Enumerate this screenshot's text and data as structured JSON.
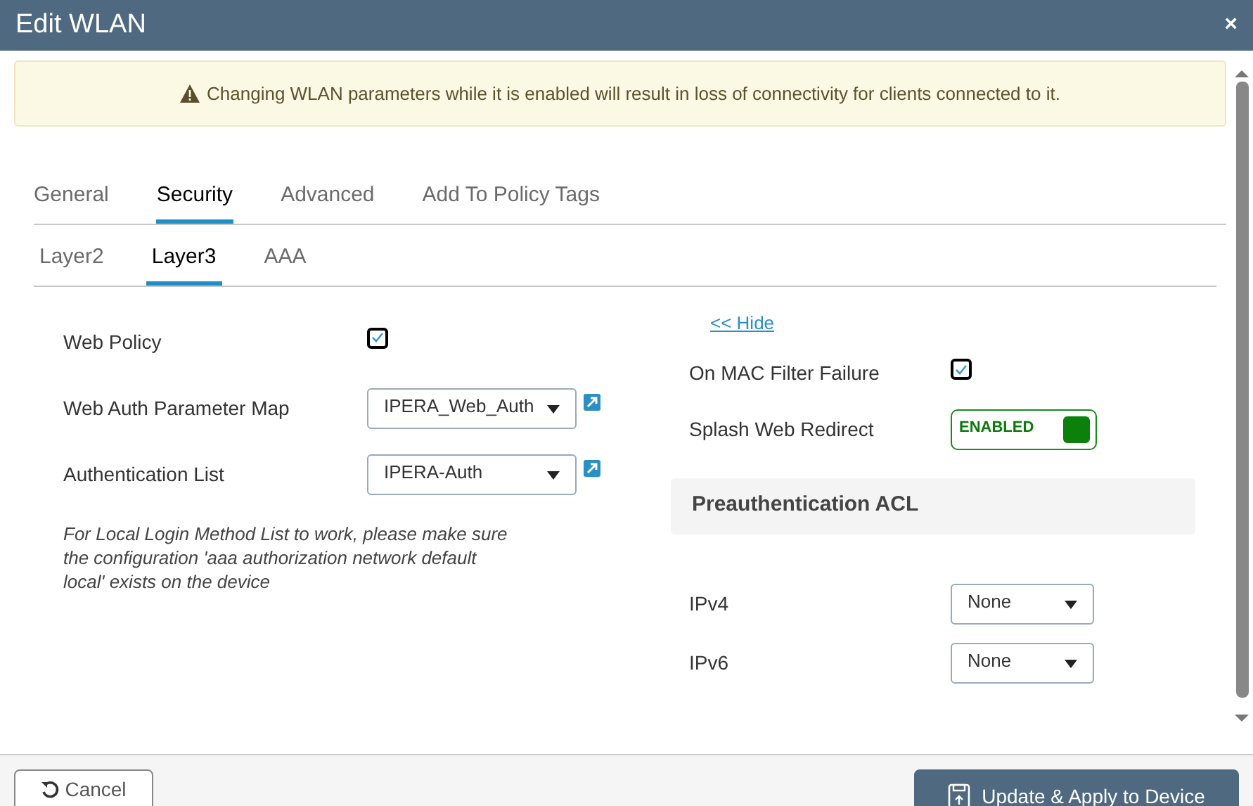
{
  "window": {
    "title": "Edit WLAN",
    "close": "×"
  },
  "alert": {
    "text": "Changing WLAN parameters while it is enabled will result in loss of connectivity for clients connected to it."
  },
  "tabs": [
    {
      "label": "General",
      "selected": false
    },
    {
      "label": "Security",
      "selected": true
    },
    {
      "label": "Advanced",
      "selected": false
    },
    {
      "label": "Add To Policy Tags",
      "selected": false
    }
  ],
  "subtabs": [
    {
      "label": "Layer2",
      "selected": false
    },
    {
      "label": "Layer3",
      "selected": true
    },
    {
      "label": "AAA",
      "selected": false
    }
  ],
  "left_fields": [
    {
      "kind": "checkbox",
      "label": "Web Policy",
      "checked": true
    },
    {
      "kind": "select",
      "label": "Web Auth Parameter Map",
      "value": "IPERA_Web_Auth"
    },
    {
      "kind": "select",
      "label": "Authentication List",
      "value": "IPERA-Auth"
    }
  ],
  "note": "For Local Login Method List to work, please make sure the configuration 'aaa authorization network default local' exists on the device",
  "hide_link": "<< Hide",
  "right_fields": [
    {
      "kind": "checkbox",
      "label": "On MAC Filter Failure",
      "checked": true
    },
    {
      "kind": "toggle",
      "label": "Splash Web Redirect",
      "on": true,
      "state_text": "ENABLED"
    }
  ],
  "section": {
    "title": "Preauthentication ACL",
    "fields": [
      {
        "label": "IPv4",
        "value": "None"
      },
      {
        "label": "IPv6",
        "value": "None"
      }
    ]
  },
  "buttons": [
    {
      "kind": "cancel",
      "label": "Cancel"
    },
    {
      "kind": "apply",
      "label": "Update & Apply to Device"
    }
  ]
}
